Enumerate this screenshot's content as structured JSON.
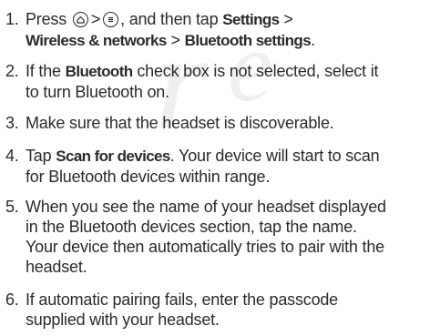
{
  "steps": [
    {
      "number": "1.",
      "text": {
        "press": "Press",
        "gt1": ">",
        "and_then_tap": ", and then tap",
        "settings": "Settings",
        "gt2": " >",
        "wireless": "Wireless & networks",
        "gt3": " > ",
        "bluetooth_settings": "Bluetooth settings",
        "period": "."
      },
      "icons": [
        "home-icon",
        "menu-icon"
      ]
    },
    {
      "number": "2.",
      "line1_a": "If the ",
      "bluetooth": "Bluetooth",
      "line1_b": " check box is not selected, select it",
      "line2": "to turn Bluetooth on."
    },
    {
      "number": "3.",
      "line1": "Make sure that the headset is discoverable."
    },
    {
      "number": "4.",
      "line1_a": "Tap ",
      "scan": "Scan for devices",
      "line1_b": ". Your device will start to scan",
      "line2": "for Bluetooth devices within range."
    },
    {
      "number": "5.",
      "line1": "When you see the name of your headset displayed",
      "line2": "in the Bluetooth devices section, tap the name.",
      "line3": "Your device then automatically tries to pair with the",
      "line4": "headset."
    },
    {
      "number": "6.",
      "line1": "If automatic pairing fails, enter the passcode",
      "line2": "supplied with your headset."
    }
  ]
}
